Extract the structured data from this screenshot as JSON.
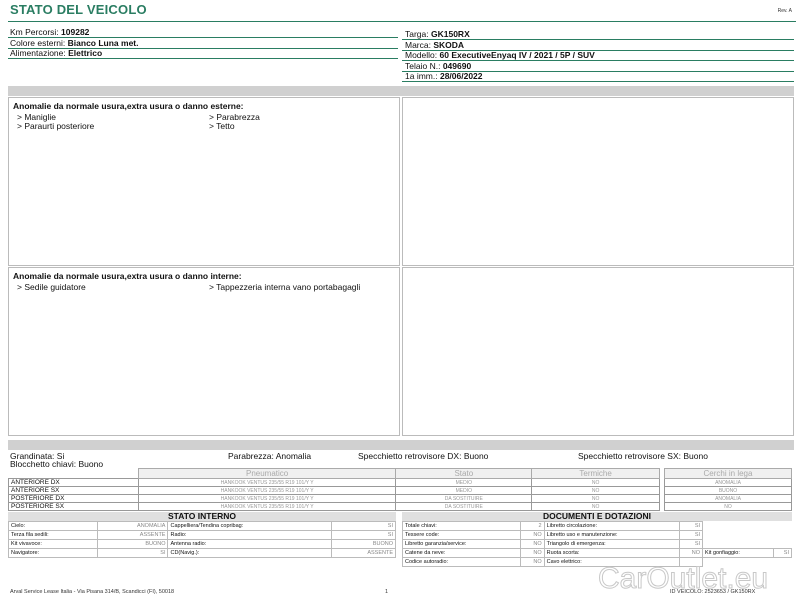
{
  "header": {
    "title": "STATO DEL VEICOLO",
    "rev": "Rev. A"
  },
  "left_info": [
    {
      "label": "Km Percorsi:",
      "value": "109282"
    },
    {
      "label": "Colore esterni:",
      "value": "Bianco Luna met."
    },
    {
      "label": "Alimentazione:",
      "value": "Elettrico"
    }
  ],
  "right_info": [
    {
      "label": "Targa:",
      "value": "GK150RX"
    },
    {
      "label": "Marca:",
      "value": "SKODA"
    },
    {
      "label": "Modello:",
      "value": "60 ExecutiveEnyaq IV / 2021 / 5P / SUV"
    },
    {
      "label": "Telaio N.:",
      "value": "049690"
    },
    {
      "label": "1a imm.:",
      "value": "28/06/2022"
    }
  ],
  "external": {
    "title": "Anomalie da normale usura,extra usura o danno esterne:",
    "col1": [
      "> Maniglie",
      "> Paraurti posteriore"
    ],
    "col2": [
      "> Parabrezza",
      "> Tetto"
    ]
  },
  "internal": {
    "title": "Anomalie da normale usura,extra usura o danno interne:",
    "col1": [
      "> Sedile guidatore"
    ],
    "col2": [
      "> Tappezzeria interna vano portabagagli"
    ]
  },
  "summary": {
    "grandinata": "Grandinata: Si",
    "parabrezza": "Parabrezza: Anomalia",
    "specchietto_dx": "Specchietto retrovisore DX: Buono",
    "specchietto_sx": "Specchietto retrovisore SX: Buono",
    "blocchetto": "Blocchetto chiavi: Buono"
  },
  "tyres": {
    "headers": [
      "Pneumatico",
      "Stato",
      "Termiche"
    ],
    "rows": [
      {
        "pos": "ANTERIORE DX",
        "model": "HANKOOK VENTUS 235/55 R19 101/Y Y",
        "stato": "MEDIO",
        "termiche": "NO"
      },
      {
        "pos": "ANTERIORE SX",
        "model": "HANKOOK VENTUS 235/55 R19 101/Y Y",
        "stato": "MEDIO",
        "termiche": "NO"
      },
      {
        "pos": "POSTERIORE DX",
        "model": "HANKOOK VENTUS 235/55 R19 101/Y Y",
        "stato": "DA SOSTITUIRE",
        "termiche": "NO"
      },
      {
        "pos": "POSTERIORE SX",
        "model": "HANKOOK VENTUS 235/55 R19 101/Y Y",
        "stato": "DA SOSTITUIRE",
        "termiche": "NO"
      }
    ],
    "cerchi_header": "Cerchi in lega",
    "cerchi": [
      "ANOMALIA",
      "BUONO",
      "ANOMALIA",
      "NO"
    ]
  },
  "stato_interno": {
    "title": "STATO INTERNO",
    "rows": [
      [
        {
          "l": "Cielo:",
          "v": "ANOMALIA"
        },
        {
          "l": "Cappelliera/Tendina copribag:",
          "v": "SI"
        }
      ],
      [
        {
          "l": "Terza fila sedili:",
          "v": "ASSENTE"
        },
        {
          "l": "Radio:",
          "v": "SI"
        }
      ],
      [
        {
          "l": "Kit vivavoce:",
          "v": "BUONO"
        },
        {
          "l": "Antenna radio:",
          "v": "BUONO"
        }
      ],
      [
        {
          "l": "Navigatore:",
          "v": "SI"
        },
        {
          "l": "CD(Navig.):",
          "v": "ASSENTE"
        }
      ]
    ]
  },
  "documenti": {
    "title": "DOCUMENTI E DOTAZIONI",
    "rows": [
      [
        {
          "l": "Totale chiavi:",
          "v": "2"
        },
        {
          "l": "Libretto circolazione:",
          "v": "SI"
        }
      ],
      [
        {
          "l": "Tessere code:",
          "v": "NO"
        },
        {
          "l": "Libretto uso e manutenzione:",
          "v": "SI"
        }
      ],
      [
        {
          "l": "Libretto garanzia/service:",
          "v": "NO"
        },
        {
          "l": "Triangolo di emergenza:",
          "v": "SI"
        }
      ],
      [
        {
          "l": "Catene da neve:",
          "v": "NO"
        },
        {
          "l": "Ruota scorta:",
          "v": "NO"
        },
        {
          "l": "Kit gonfiaggio:",
          "v": "SI"
        }
      ],
      [
        {
          "l": "Codice autoradio:",
          "v": "NO"
        },
        {
          "l": "Cavo elettrico:",
          "v": ""
        }
      ]
    ]
  },
  "footer": {
    "company": "Arval Service Lease Italia - Via Pisana 314/B, Scandicci (FI), 50018",
    "page": "1",
    "ref": "ID VEICOLO: 2523653 / GK150RX",
    "watermark": "CarOutlet.eu"
  }
}
